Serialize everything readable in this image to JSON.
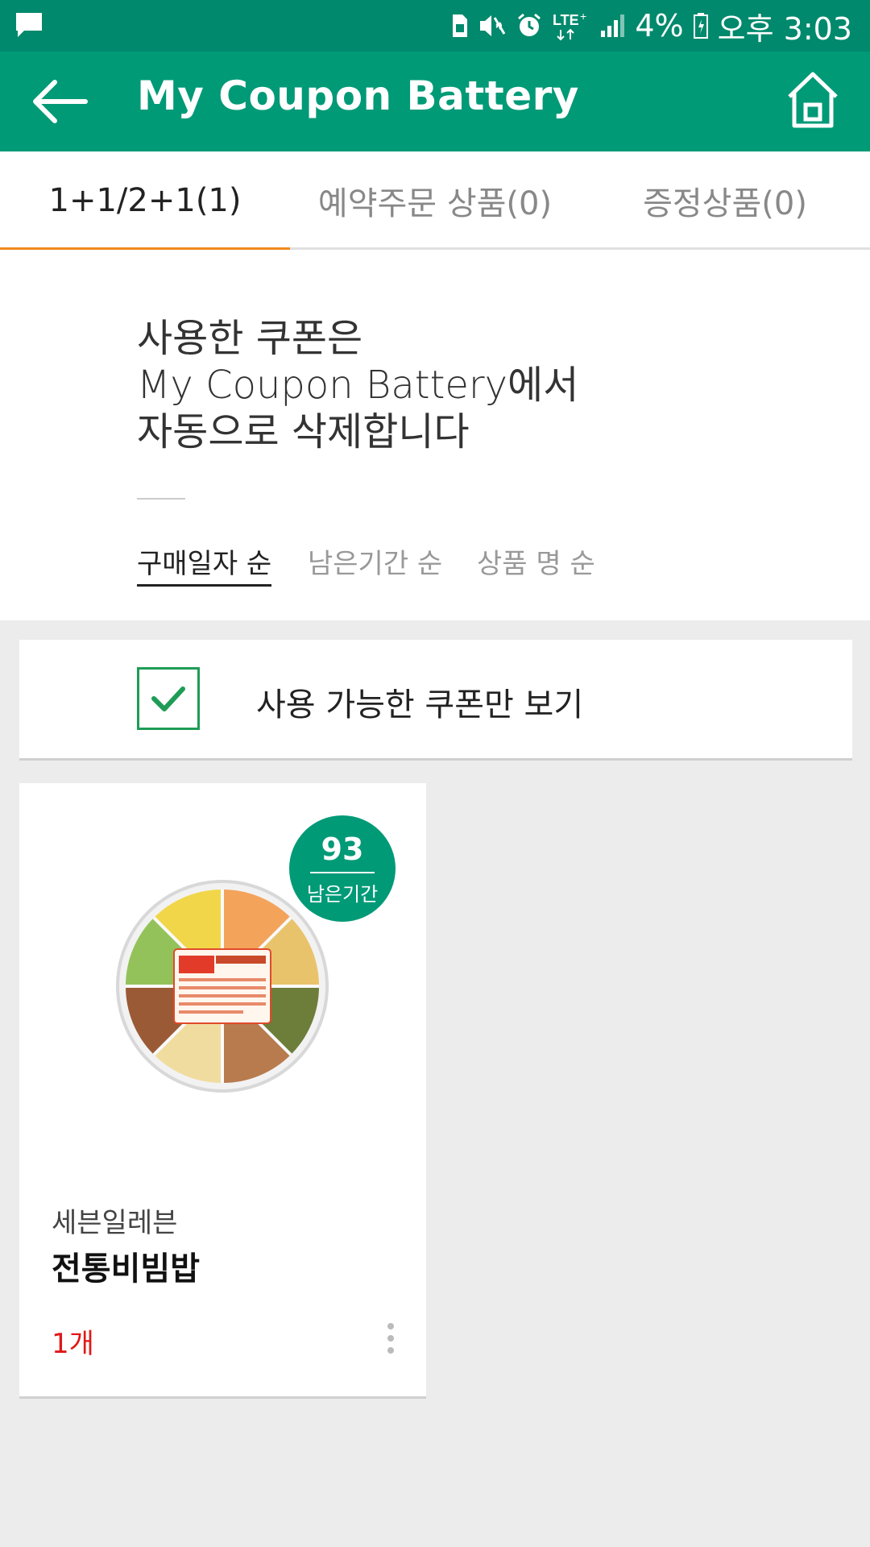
{
  "status_bar": {
    "battery_percent": "4%",
    "time": "오후 3:03",
    "network": "LTE+",
    "icons": [
      "chat-icon",
      "sim-icon",
      "mute-icon",
      "alarm-icon",
      "lte-icon",
      "signal-icon",
      "battery-icon"
    ]
  },
  "app_bar": {
    "title": "My Coupon Battery",
    "back_icon": "arrow-left-icon",
    "home_icon": "home-icon",
    "color": "#009a77"
  },
  "tabs": [
    {
      "label": "1+1/2+1(1)",
      "active": true
    },
    {
      "label": "예약주문 상품(0)",
      "active": false
    },
    {
      "label": "증정상품(0)",
      "active": false
    }
  ],
  "tab_indicator_color": "#f08a1c",
  "notice": {
    "lines": [
      "사용한 쿠폰은",
      "My Coupon Battery에서",
      "자동으로 삭제합니다"
    ]
  },
  "sort_options": [
    {
      "label": "구매일자 순",
      "active": true
    },
    {
      "label": "남은기간 순",
      "active": false
    },
    {
      "label": "상품 명 순",
      "active": false
    }
  ],
  "filter": {
    "label": "사용 가능한 쿠폰만 보기",
    "checked": true
  },
  "coupons": [
    {
      "days_left": "93",
      "days_left_label": "남은기간",
      "brand": "세븐일레븐",
      "name": "전통비빔밥",
      "quantity": "1개",
      "image": "bibimbap-product-image"
    }
  ]
}
